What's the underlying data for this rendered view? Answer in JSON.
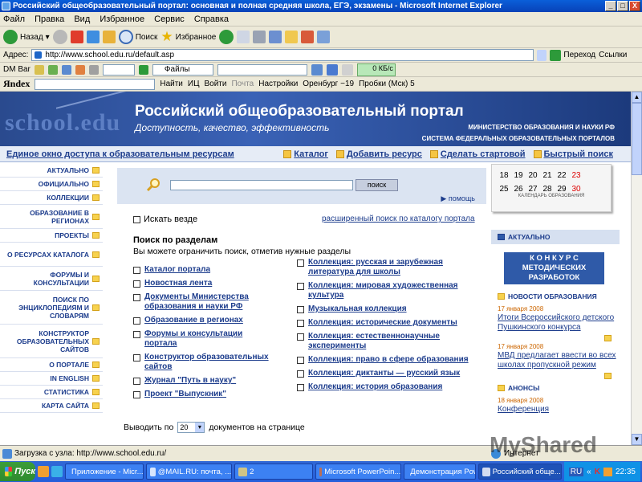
{
  "window": {
    "title": "Российский общеобразовательный портал: основная и полная средняя школа, ЕГЭ, экзамены - Microsoft Internet Explorer",
    "controls": [
      "_",
      "□",
      "X"
    ]
  },
  "menu": [
    "Файл",
    "Правка",
    "Вид",
    "Избранное",
    "Сервис",
    "Справка"
  ],
  "toolbar": {
    "back": "Назад",
    "search": "Поиск",
    "favorites": "Избранное"
  },
  "address": {
    "label": "Адрес:",
    "url": "http://www.school.edu.ru/default.asp",
    "go": "Переход",
    "links": "Ссылки"
  },
  "dmbar": {
    "label": "DM Bar",
    "files": "Файлы",
    "kb": "0 КБ/с"
  },
  "yandex": {
    "logo": "Яndex",
    "find": "Найти",
    "ic": "ИЦ",
    "login": "Войти",
    "mail": "Почта",
    "settings": "Настройки",
    "weather": "Оренбург −19",
    "traffic": "Пробки (Мск) 5"
  },
  "banner": {
    "logo": "school.edu",
    "title": "Российский общеобразовательный портал",
    "subtitle": "Доступность, качество, эффективность",
    "ministry": "МИНИСТЕРСТВО ОБРАЗОВАНИЯ И НАУКИ РФ",
    "system": "СИСТЕМА ФЕДЕРАЛЬНЫХ ОБРАЗОВАТЕЛЬНЫХ ПОРТАЛОВ"
  },
  "links": {
    "window": "Единое окно доступа к образовательным ресурсам",
    "catalog": "Каталог",
    "add": "Добавить ресурс",
    "start": "Сделать стартовой",
    "quick": "Быстрый поиск"
  },
  "leftnav": [
    "АКТУАЛЬНО",
    "ОФИЦИАЛЬНО",
    "КОЛЛЕКЦИИ",
    "ОБРАЗОВАНИЕ В РЕГИОНАХ",
    "ПРОЕКТЫ",
    "О РЕСУРСАХ КАТАЛОГА",
    "ФОРУМЫ И КОНСУЛЬТАЦИИ",
    "ПОИСК ПО ЭНЦИКЛОПЕДИЯМ И СЛОВАРЯМ",
    "КОНСТРУКТОР ОБРАЗОВАТЕЛЬНЫХ САЙТОВ",
    "О ПОРТАЛЕ",
    "IN ENGLISH",
    "СТАТИСТИКА",
    "КАРТА САЙТА"
  ],
  "search": {
    "button": "поиск",
    "help": "помощь",
    "everywhere": "Искать везде",
    "advanced": "расширенный поиск по каталогу портала",
    "section_title": "Поиск по разделам",
    "section_sub": "Вы можете ограничить поиск, отметив нужные разделы",
    "left": [
      "Каталог портала",
      "Новостная лента",
      "Документы Министерства образования и науки РФ",
      "Образование в регионах",
      "Форумы и консультации портала",
      "Конструктор образовательных сайтов",
      "Журнал \"Путь в науку\"",
      "Проект \"Выпускник\""
    ],
    "right": [
      "Коллекция: русская и зарубежная литература для школы",
      "Коллекция: мировая художественная культура",
      "Музыкальная коллекция",
      "Коллекция: исторические документы",
      "Коллекция: естественнонаучные эксперименты",
      "Коллекция: право в сфере образования",
      "Коллекция: диктанты — русский язык",
      "Коллекция: история образования"
    ],
    "perpage_pre": "Выводить по",
    "perpage_val": "20",
    "perpage_post": "документов на странице"
  },
  "calendar": {
    "row1": [
      "18",
      "19",
      "20",
      "21",
      "22",
      "23"
    ],
    "row2": [
      "25",
      "26",
      "27",
      "28",
      "29",
      "30"
    ],
    "caption": "КАЛЕНДАРЬ ОБРАЗОВАНИЯ"
  },
  "rightcol": {
    "actual": "АКТУАЛЬНО",
    "contest": "К О Н К У Р С МЕТОДИЧЕСКИХ РАЗРАБОТОК",
    "news_head": "НОВОСТИ ОБРАЗОВАНИЯ",
    "news": [
      {
        "date": "17 января 2008",
        "text": "Итоги Всероссийского детского Пушкинского конкурса"
      },
      {
        "date": "17 января 2008",
        "text": "МВД предлагает ввести во всех школах пропускной режим"
      }
    ],
    "ann_head": "АНОНСЫ",
    "ann_date": "18 января 2008",
    "ann_text": "Конференция"
  },
  "status": {
    "text": "Загрузка с узла: http://www.school.edu.ru/",
    "zone": "Интернет"
  },
  "watermark": {
    "a": "My",
    "b": "Shared"
  },
  "taskbar": {
    "start": "Пуск",
    "tasks": [
      "Приложение - Micr...",
      "@MAIL.RU: почта, ...",
      "2",
      "Microsoft PowerPoin...",
      "Демонстрация Pow...",
      "Российский обще..."
    ],
    "lang": "RU",
    "time": "22:35"
  }
}
